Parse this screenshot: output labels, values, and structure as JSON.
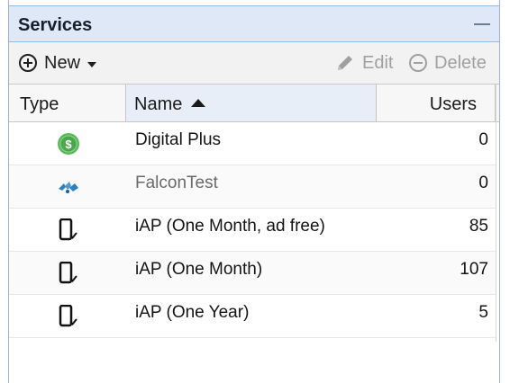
{
  "panel": {
    "title": "Services"
  },
  "toolbar": {
    "new_label": "New",
    "edit_label": "Edit",
    "delete_label": "Delete"
  },
  "grid": {
    "columns": {
      "type": "Type",
      "name": "Name",
      "users": "Users"
    },
    "sort": {
      "column": "Name",
      "direction": "ascending"
    },
    "rows": [
      {
        "icon": "dollar-coin-icon",
        "name": "Digital Plus",
        "users": "0"
      },
      {
        "icon": "falcon-logo-icon",
        "name": "FalconTest",
        "users": "0"
      },
      {
        "icon": "mobile-check-icon",
        "name": "iAP (One Month, ad free)",
        "users": "85"
      },
      {
        "icon": "mobile-check-icon",
        "name": "iAP (One Month)",
        "users": "107"
      },
      {
        "icon": "mobile-check-icon",
        "name": "iAP (One Year)",
        "users": "5"
      }
    ]
  },
  "colors": {
    "header_bg": "#dfe8f6",
    "coin_green": "#5cb85c",
    "falcon_blue": "#2f7fc1"
  }
}
